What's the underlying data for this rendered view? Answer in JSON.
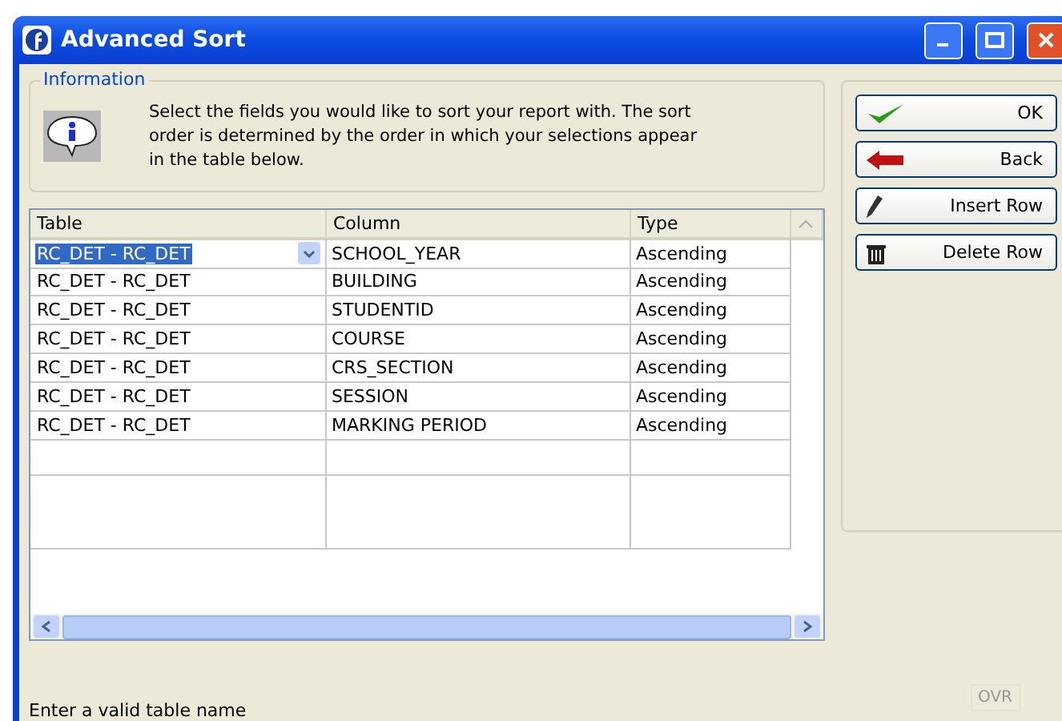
{
  "window": {
    "title": "Advanced Sort"
  },
  "information": {
    "title": "Information",
    "message": "Select the fields you would like to sort your report with. The sort order is determined by the order in which your selections appear in the table below."
  },
  "table": {
    "columns": [
      "Table",
      "Column",
      "Type"
    ],
    "rows": [
      {
        "table": "RC_DET - RC_DET",
        "column": "SCHOOL_YEAR",
        "type": "Ascending",
        "selected": true
      },
      {
        "table": "RC_DET - RC_DET",
        "column": "BUILDING",
        "type": "Ascending",
        "selected": false
      },
      {
        "table": "RC_DET - RC_DET",
        "column": "STUDENTID",
        "type": "Ascending",
        "selected": false
      },
      {
        "table": "RC_DET - RC_DET",
        "column": "COURSE",
        "type": "Ascending",
        "selected": false
      },
      {
        "table": "RC_DET - RC_DET",
        "column": "CRS_SECTION",
        "type": "Ascending",
        "selected": false
      },
      {
        "table": "RC_DET - RC_DET",
        "column": "SESSION",
        "type": "Ascending",
        "selected": false
      },
      {
        "table": "RC_DET - RC_DET",
        "column": "MARKING PERIOD",
        "type": "Ascending",
        "selected": false
      }
    ]
  },
  "buttons": [
    {
      "kind": "ok",
      "label": "OK"
    },
    {
      "kind": "back",
      "label": "Back"
    },
    {
      "kind": "insert",
      "label": "Insert Row"
    },
    {
      "kind": "delete",
      "label": "Delete Row"
    }
  ],
  "status_bar": {
    "message": "Enter a valid table name",
    "mode": "OVR"
  }
}
